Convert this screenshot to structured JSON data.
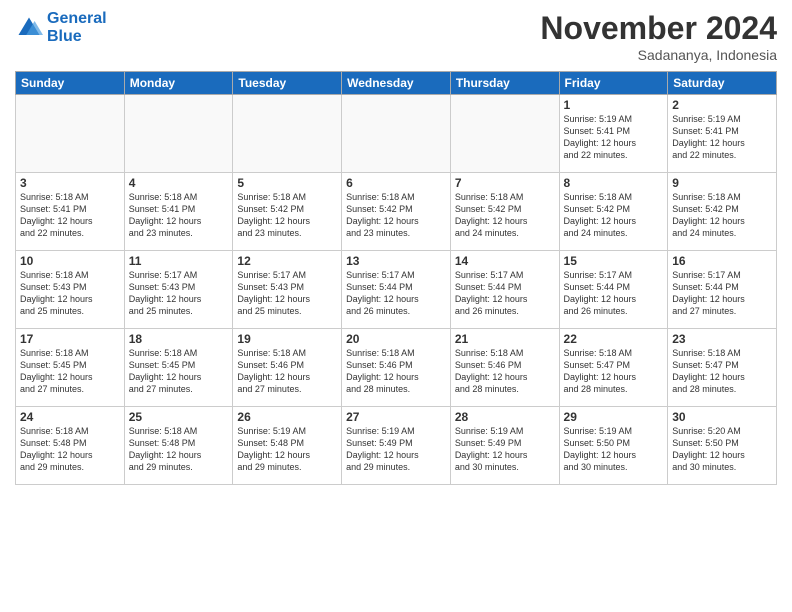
{
  "logo": {
    "line1": "General",
    "line2": "Blue"
  },
  "title": "November 2024",
  "location": "Sadananya, Indonesia",
  "weekdays": [
    "Sunday",
    "Monday",
    "Tuesday",
    "Wednesday",
    "Thursday",
    "Friday",
    "Saturday"
  ],
  "weeks": [
    [
      {
        "day": "",
        "info": ""
      },
      {
        "day": "",
        "info": ""
      },
      {
        "day": "",
        "info": ""
      },
      {
        "day": "",
        "info": ""
      },
      {
        "day": "",
        "info": ""
      },
      {
        "day": "1",
        "info": "Sunrise: 5:19 AM\nSunset: 5:41 PM\nDaylight: 12 hours\nand 22 minutes."
      },
      {
        "day": "2",
        "info": "Sunrise: 5:19 AM\nSunset: 5:41 PM\nDaylight: 12 hours\nand 22 minutes."
      }
    ],
    [
      {
        "day": "3",
        "info": "Sunrise: 5:18 AM\nSunset: 5:41 PM\nDaylight: 12 hours\nand 22 minutes."
      },
      {
        "day": "4",
        "info": "Sunrise: 5:18 AM\nSunset: 5:41 PM\nDaylight: 12 hours\nand 23 minutes."
      },
      {
        "day": "5",
        "info": "Sunrise: 5:18 AM\nSunset: 5:42 PM\nDaylight: 12 hours\nand 23 minutes."
      },
      {
        "day": "6",
        "info": "Sunrise: 5:18 AM\nSunset: 5:42 PM\nDaylight: 12 hours\nand 23 minutes."
      },
      {
        "day": "7",
        "info": "Sunrise: 5:18 AM\nSunset: 5:42 PM\nDaylight: 12 hours\nand 24 minutes."
      },
      {
        "day": "8",
        "info": "Sunrise: 5:18 AM\nSunset: 5:42 PM\nDaylight: 12 hours\nand 24 minutes."
      },
      {
        "day": "9",
        "info": "Sunrise: 5:18 AM\nSunset: 5:42 PM\nDaylight: 12 hours\nand 24 minutes."
      }
    ],
    [
      {
        "day": "10",
        "info": "Sunrise: 5:18 AM\nSunset: 5:43 PM\nDaylight: 12 hours\nand 25 minutes."
      },
      {
        "day": "11",
        "info": "Sunrise: 5:17 AM\nSunset: 5:43 PM\nDaylight: 12 hours\nand 25 minutes."
      },
      {
        "day": "12",
        "info": "Sunrise: 5:17 AM\nSunset: 5:43 PM\nDaylight: 12 hours\nand 25 minutes."
      },
      {
        "day": "13",
        "info": "Sunrise: 5:17 AM\nSunset: 5:44 PM\nDaylight: 12 hours\nand 26 minutes."
      },
      {
        "day": "14",
        "info": "Sunrise: 5:17 AM\nSunset: 5:44 PM\nDaylight: 12 hours\nand 26 minutes."
      },
      {
        "day": "15",
        "info": "Sunrise: 5:17 AM\nSunset: 5:44 PM\nDaylight: 12 hours\nand 26 minutes."
      },
      {
        "day": "16",
        "info": "Sunrise: 5:17 AM\nSunset: 5:44 PM\nDaylight: 12 hours\nand 27 minutes."
      }
    ],
    [
      {
        "day": "17",
        "info": "Sunrise: 5:18 AM\nSunset: 5:45 PM\nDaylight: 12 hours\nand 27 minutes."
      },
      {
        "day": "18",
        "info": "Sunrise: 5:18 AM\nSunset: 5:45 PM\nDaylight: 12 hours\nand 27 minutes."
      },
      {
        "day": "19",
        "info": "Sunrise: 5:18 AM\nSunset: 5:46 PM\nDaylight: 12 hours\nand 27 minutes."
      },
      {
        "day": "20",
        "info": "Sunrise: 5:18 AM\nSunset: 5:46 PM\nDaylight: 12 hours\nand 28 minutes."
      },
      {
        "day": "21",
        "info": "Sunrise: 5:18 AM\nSunset: 5:46 PM\nDaylight: 12 hours\nand 28 minutes."
      },
      {
        "day": "22",
        "info": "Sunrise: 5:18 AM\nSunset: 5:47 PM\nDaylight: 12 hours\nand 28 minutes."
      },
      {
        "day": "23",
        "info": "Sunrise: 5:18 AM\nSunset: 5:47 PM\nDaylight: 12 hours\nand 28 minutes."
      }
    ],
    [
      {
        "day": "24",
        "info": "Sunrise: 5:18 AM\nSunset: 5:48 PM\nDaylight: 12 hours\nand 29 minutes."
      },
      {
        "day": "25",
        "info": "Sunrise: 5:18 AM\nSunset: 5:48 PM\nDaylight: 12 hours\nand 29 minutes."
      },
      {
        "day": "26",
        "info": "Sunrise: 5:19 AM\nSunset: 5:48 PM\nDaylight: 12 hours\nand 29 minutes."
      },
      {
        "day": "27",
        "info": "Sunrise: 5:19 AM\nSunset: 5:49 PM\nDaylight: 12 hours\nand 29 minutes."
      },
      {
        "day": "28",
        "info": "Sunrise: 5:19 AM\nSunset: 5:49 PM\nDaylight: 12 hours\nand 30 minutes."
      },
      {
        "day": "29",
        "info": "Sunrise: 5:19 AM\nSunset: 5:50 PM\nDaylight: 12 hours\nand 30 minutes."
      },
      {
        "day": "30",
        "info": "Sunrise: 5:20 AM\nSunset: 5:50 PM\nDaylight: 12 hours\nand 30 minutes."
      }
    ]
  ]
}
